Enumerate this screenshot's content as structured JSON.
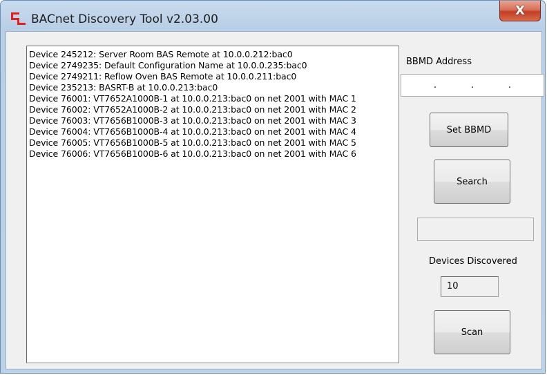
{
  "window": {
    "title": "BACnet Discovery Tool v2.03.00",
    "close_label": "X"
  },
  "devices": [
    "Device 245212: Server Room BAS Remote at 10.0.0.212:bac0",
    "Device 2749235: Default Configuration Name at 10.0.0.235:bac0",
    "Device 2749211: Reflow Oven BAS Remote at 10.0.0.211:bac0",
    "Device 235213: BASRT-B at 10.0.0.213:bac0",
    "Device 76001: VT7652A1000B-1 at 10.0.0.213:bac0 on net 2001 with MAC 1",
    "Device 76002: VT7652A1000B-2 at 10.0.0.213:bac0 on net 2001 with MAC 2",
    "Device 76003: VT7656B1000B-3 at 10.0.0.213:bac0 on net 2001 with MAC 3",
    "Device 76004: VT7656B1000B-4 at 10.0.0.213:bac0 on net 2001 with MAC 4",
    "Device 76005: VT7656B1000B-5 at 10.0.0.213:bac0 on net 2001 with MAC 5",
    "Device 76006: VT7656B1000B-6 at 10.0.0.213:bac0 on net 2001 with MAC 6"
  ],
  "bbmd": {
    "label": "BBMD Address",
    "dot": "."
  },
  "buttons": {
    "set_bbmd": "Set BBMD",
    "search": "Search",
    "scan": "Scan"
  },
  "discovered": {
    "label": "Devices Discovered",
    "count": "10"
  },
  "colors": {
    "app_icon": "#e02020",
    "close_button": "#c94a32",
    "title_bar": "#bfd4ea"
  }
}
